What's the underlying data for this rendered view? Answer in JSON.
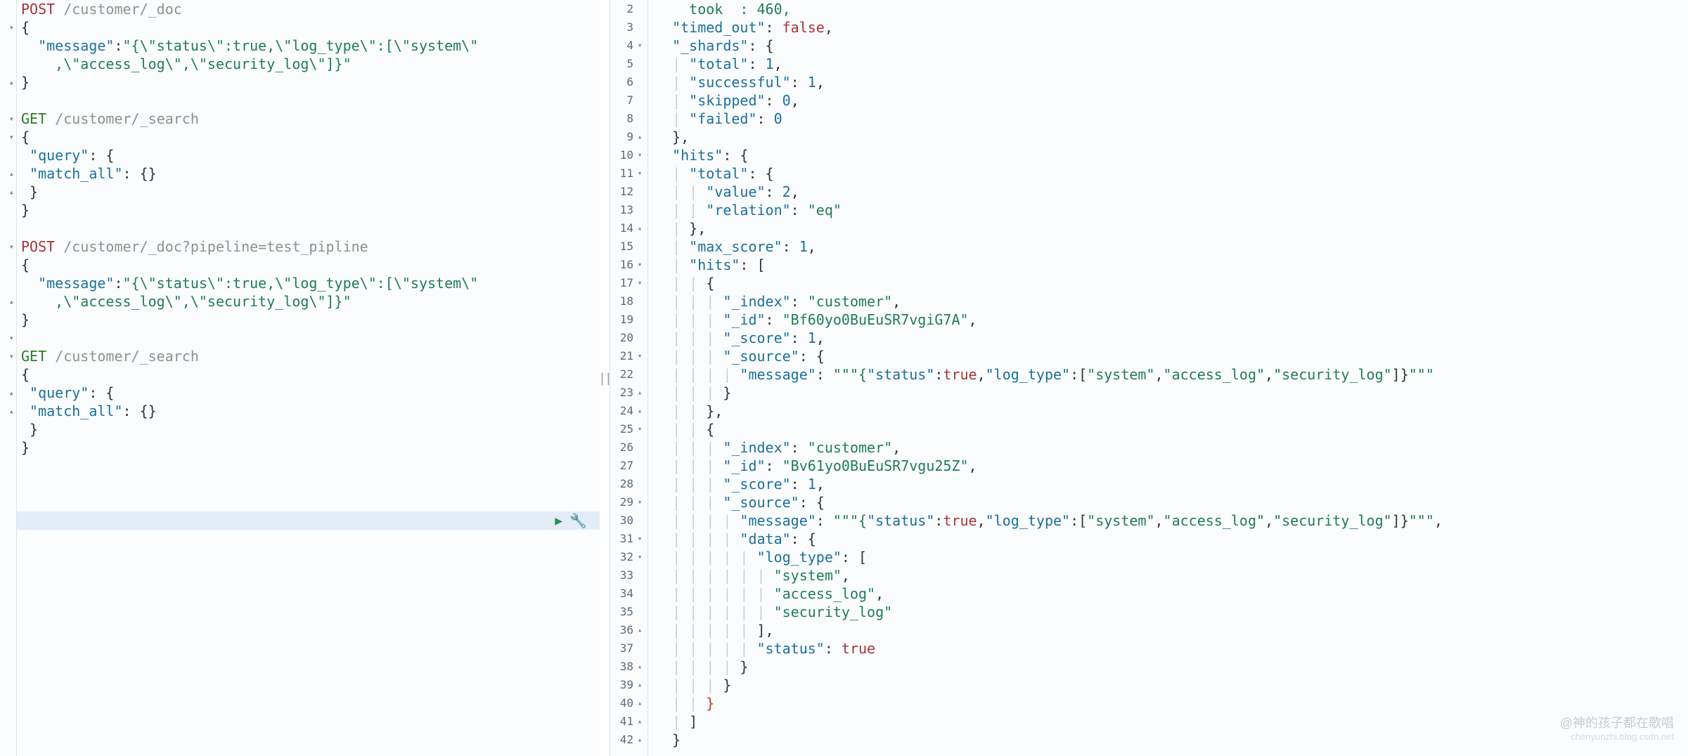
{
  "watermark": {
    "line1": "@神的孩子都在歌唱",
    "line2": "chenyunzhi.blog.csdn.net"
  },
  "icons": {
    "play": "▶",
    "wrench": "🔧",
    "divider": "||"
  },
  "left_fold_markers": {
    "1": "▾",
    "4": "▴",
    "6": "▾",
    "7": "▾",
    "9": "▴",
    "10": "▴",
    "13": "▾",
    "16": "▴",
    "18": "▾",
    "19": "▾",
    "21": "▴",
    "22": "▴"
  },
  "left_lines": [
    [
      {
        "c": "tok-method-post",
        "t": "POST"
      },
      {
        "c": "",
        "t": " "
      },
      {
        "c": "tok-path",
        "t": "/customer/_doc"
      }
    ],
    [
      {
        "c": "tok-punc",
        "t": "{"
      }
    ],
    [
      {
        "c": "",
        "t": "  "
      },
      {
        "c": "tok-key",
        "t": "\"message\""
      },
      {
        "c": "tok-punc",
        "t": ":"
      },
      {
        "c": "tok-string",
        "t": "\"{\\\"status\\\":true,\\\"log_type\\\":[\\\"system\\\""
      }
    ],
    [
      {
        "c": "",
        "t": "    "
      },
      {
        "c": "tok-string",
        "t": ",\\\"access_log\\\",\\\"security_log\\\"]}\""
      }
    ],
    [
      {
        "c": "tok-punc",
        "t": "}"
      }
    ],
    [
      {
        "c": "",
        "t": ""
      }
    ],
    [
      {
        "c": "tok-method-get",
        "t": "GET"
      },
      {
        "c": "",
        "t": " "
      },
      {
        "c": "tok-path",
        "t": "/customer/_search"
      }
    ],
    [
      {
        "c": "tok-punc",
        "t": "{"
      }
    ],
    [
      {
        "c": "",
        "t": " "
      },
      {
        "c": "tok-key",
        "t": "\"query\""
      },
      {
        "c": "tok-punc",
        "t": ": {"
      }
    ],
    [
      {
        "c": "",
        "t": " "
      },
      {
        "c": "tok-key",
        "t": "\"match_all\""
      },
      {
        "c": "tok-punc",
        "t": ": {}"
      }
    ],
    [
      {
        "c": "",
        "t": " "
      },
      {
        "c": "tok-punc",
        "t": "}"
      }
    ],
    [
      {
        "c": "tok-punc",
        "t": "}"
      }
    ],
    [
      {
        "c": "",
        "t": ""
      }
    ],
    [
      {
        "c": "tok-method-post",
        "t": "POST"
      },
      {
        "c": "",
        "t": " "
      },
      {
        "c": "tok-path",
        "t": "/customer/_doc?pipeline=test_pipline"
      }
    ],
    [
      {
        "c": "tok-punc",
        "t": "{"
      }
    ],
    [
      {
        "c": "",
        "t": "  "
      },
      {
        "c": "tok-key",
        "t": "\"message\""
      },
      {
        "c": "tok-punc",
        "t": ":"
      },
      {
        "c": "tok-string",
        "t": "\"{\\\"status\\\":true,\\\"log_type\\\":[\\\"system\\\""
      }
    ],
    [
      {
        "c": "",
        "t": "    "
      },
      {
        "c": "tok-string",
        "t": ",\\\"access_log\\\",\\\"security_log\\\"]}\""
      }
    ],
    [
      {
        "c": "tok-punc",
        "t": "}"
      }
    ],
    [
      {
        "c": "",
        "t": ""
      }
    ],
    [
      {
        "c": "tok-method-get",
        "t": "GET"
      },
      {
        "c": "",
        "t": " "
      },
      {
        "c": "tok-path",
        "t": "/customer/_search"
      }
    ],
    [
      {
        "c": "tok-punc",
        "t": "{"
      }
    ],
    [
      {
        "c": "",
        "t": " "
      },
      {
        "c": "tok-key",
        "t": "\"query\""
      },
      {
        "c": "tok-punc",
        "t": ": {"
      }
    ],
    [
      {
        "c": "",
        "t": " "
      },
      {
        "c": "tok-key",
        "t": "\"match_all\""
      },
      {
        "c": "tok-punc",
        "t": ": {}"
      }
    ],
    [
      {
        "c": "",
        "t": " "
      },
      {
        "c": "tok-punc",
        "t": "}"
      }
    ],
    [
      {
        "c": "tok-punc",
        "t": "}"
      }
    ]
  ],
  "right_gutter": [
    {
      "n": "2",
      "f": ""
    },
    {
      "n": "3",
      "f": ""
    },
    {
      "n": "4",
      "f": "▾"
    },
    {
      "n": "5",
      "f": ""
    },
    {
      "n": "6",
      "f": ""
    },
    {
      "n": "7",
      "f": ""
    },
    {
      "n": "8",
      "f": ""
    },
    {
      "n": "9",
      "f": "▴"
    },
    {
      "n": "10",
      "f": "▾"
    },
    {
      "n": "11",
      "f": "▾"
    },
    {
      "n": "12",
      "f": ""
    },
    {
      "n": "13",
      "f": ""
    },
    {
      "n": "14",
      "f": "▴"
    },
    {
      "n": "15",
      "f": ""
    },
    {
      "n": "16",
      "f": "▾"
    },
    {
      "n": "17",
      "f": "▾"
    },
    {
      "n": "18",
      "f": ""
    },
    {
      "n": "19",
      "f": ""
    },
    {
      "n": "20",
      "f": ""
    },
    {
      "n": "21",
      "f": "▾"
    },
    {
      "n": "22",
      "f": ""
    },
    {
      "n": "23",
      "f": "▴"
    },
    {
      "n": "24",
      "f": "▴"
    },
    {
      "n": "25",
      "f": "▾"
    },
    {
      "n": "26",
      "f": ""
    },
    {
      "n": "27",
      "f": ""
    },
    {
      "n": "28",
      "f": ""
    },
    {
      "n": "29",
      "f": "▾"
    },
    {
      "n": "30",
      "f": ""
    },
    {
      "n": "31",
      "f": "▾"
    },
    {
      "n": "32",
      "f": "▾"
    },
    {
      "n": "33",
      "f": ""
    },
    {
      "n": "34",
      "f": ""
    },
    {
      "n": "35",
      "f": ""
    },
    {
      "n": "36",
      "f": "▴"
    },
    {
      "n": "37",
      "f": ""
    },
    {
      "n": "38",
      "f": "▴"
    },
    {
      "n": "39",
      "f": "▴"
    },
    {
      "n": "40",
      "f": "▴"
    },
    {
      "n": "41",
      "f": "▴"
    },
    {
      "n": "42",
      "f": "▴"
    }
  ],
  "right_lines": [
    [
      {
        "c": "",
        "t": "  "
      },
      {
        "c": "tok-string",
        "t": "  took  : 460,"
      }
    ],
    [
      {
        "c": "",
        "t": "  "
      },
      {
        "c": "tok-key",
        "t": "\"timed_out\""
      },
      {
        "c": "tok-punc",
        "t": ": "
      },
      {
        "c": "tok-bool",
        "t": "false"
      },
      {
        "c": "tok-punc",
        "t": ","
      }
    ],
    [
      {
        "c": "",
        "t": "  "
      },
      {
        "c": "tok-key",
        "t": "\"_shards\""
      },
      {
        "c": "tok-punc",
        "t": ": {"
      }
    ],
    [
      {
        "c": "indent-guide",
        "t": "  | "
      },
      {
        "c": "tok-key",
        "t": "\"total\""
      },
      {
        "c": "tok-punc",
        "t": ": "
      },
      {
        "c": "tok-number",
        "t": "1"
      },
      {
        "c": "tok-punc",
        "t": ","
      }
    ],
    [
      {
        "c": "indent-guide",
        "t": "  | "
      },
      {
        "c": "tok-key",
        "t": "\"successful\""
      },
      {
        "c": "tok-punc",
        "t": ": "
      },
      {
        "c": "tok-number",
        "t": "1"
      },
      {
        "c": "tok-punc",
        "t": ","
      }
    ],
    [
      {
        "c": "indent-guide",
        "t": "  | "
      },
      {
        "c": "tok-key",
        "t": "\"skipped\""
      },
      {
        "c": "tok-punc",
        "t": ": "
      },
      {
        "c": "tok-number",
        "t": "0"
      },
      {
        "c": "tok-punc",
        "t": ","
      }
    ],
    [
      {
        "c": "indent-guide",
        "t": "  | "
      },
      {
        "c": "tok-key",
        "t": "\"failed\""
      },
      {
        "c": "tok-punc",
        "t": ": "
      },
      {
        "c": "tok-number",
        "t": "0"
      }
    ],
    [
      {
        "c": "",
        "t": "  "
      },
      {
        "c": "tok-punc",
        "t": "},"
      }
    ],
    [
      {
        "c": "",
        "t": "  "
      },
      {
        "c": "tok-key",
        "t": "\"hits\""
      },
      {
        "c": "tok-punc",
        "t": ": {"
      }
    ],
    [
      {
        "c": "indent-guide",
        "t": "  | "
      },
      {
        "c": "tok-key",
        "t": "\"total\""
      },
      {
        "c": "tok-punc",
        "t": ": {"
      }
    ],
    [
      {
        "c": "indent-guide",
        "t": "  | | "
      },
      {
        "c": "tok-key",
        "t": "\"value\""
      },
      {
        "c": "tok-punc",
        "t": ": "
      },
      {
        "c": "tok-number",
        "t": "2"
      },
      {
        "c": "tok-punc",
        "t": ","
      }
    ],
    [
      {
        "c": "indent-guide",
        "t": "  | | "
      },
      {
        "c": "tok-key",
        "t": "\"relation\""
      },
      {
        "c": "tok-punc",
        "t": ": "
      },
      {
        "c": "tok-string",
        "t": "\"eq\""
      }
    ],
    [
      {
        "c": "indent-guide",
        "t": "  | "
      },
      {
        "c": "tok-punc",
        "t": "},"
      }
    ],
    [
      {
        "c": "indent-guide",
        "t": "  | "
      },
      {
        "c": "tok-key",
        "t": "\"max_score\""
      },
      {
        "c": "tok-punc",
        "t": ": "
      },
      {
        "c": "tok-number",
        "t": "1"
      },
      {
        "c": "tok-punc",
        "t": ","
      }
    ],
    [
      {
        "c": "indent-guide",
        "t": "  | "
      },
      {
        "c": "tok-key",
        "t": "\"hits\""
      },
      {
        "c": "tok-punc",
        "t": ": ["
      }
    ],
    [
      {
        "c": "indent-guide",
        "t": "  | | "
      },
      {
        "c": "tok-punc",
        "t": "{"
      }
    ],
    [
      {
        "c": "indent-guide",
        "t": "  | | | "
      },
      {
        "c": "tok-key",
        "t": "\"_index\""
      },
      {
        "c": "tok-punc",
        "t": ": "
      },
      {
        "c": "tok-string",
        "t": "\"customer\""
      },
      {
        "c": "tok-punc",
        "t": ","
      }
    ],
    [
      {
        "c": "indent-guide",
        "t": "  | | | "
      },
      {
        "c": "tok-key",
        "t": "\"_id\""
      },
      {
        "c": "tok-punc",
        "t": ": "
      },
      {
        "c": "tok-string",
        "t": "\"Bf60yo0BuEuSR7vgiG7A\""
      },
      {
        "c": "tok-punc",
        "t": ","
      }
    ],
    [
      {
        "c": "indent-guide",
        "t": "  | | | "
      },
      {
        "c": "tok-key",
        "t": "\"_score\""
      },
      {
        "c": "tok-punc",
        "t": ": "
      },
      {
        "c": "tok-number",
        "t": "1"
      },
      {
        "c": "tok-punc",
        "t": ","
      }
    ],
    [
      {
        "c": "indent-guide",
        "t": "  | | | "
      },
      {
        "c": "tok-key",
        "t": "\"_source\""
      },
      {
        "c": "tok-punc",
        "t": ": {"
      }
    ],
    [
      {
        "c": "indent-guide",
        "t": "  | | | | "
      },
      {
        "c": "tok-key",
        "t": "\"message\""
      },
      {
        "c": "tok-punc",
        "t": ": "
      },
      {
        "c": "tok-string",
        "t": "\"\"\"{"
      },
      {
        "c": "tok-key",
        "t": "\"status\""
      },
      {
        "c": "tok-punc",
        "t": ":"
      },
      {
        "c": "tok-bool",
        "t": "true"
      },
      {
        "c": "tok-punc",
        "t": ","
      },
      {
        "c": "tok-key",
        "t": "\"log_type\""
      },
      {
        "c": "tok-punc",
        "t": ":["
      },
      {
        "c": "tok-string",
        "t": "\"system\""
      },
      {
        "c": "tok-punc",
        "t": ","
      },
      {
        "c": "tok-string",
        "t": "\"access_log\""
      },
      {
        "c": "tok-punc",
        "t": ","
      },
      {
        "c": "tok-string",
        "t": "\"security_log\""
      },
      {
        "c": "tok-punc",
        "t": "]}"
      },
      {
        "c": "tok-string",
        "t": "\"\"\""
      }
    ],
    [
      {
        "c": "indent-guide",
        "t": "  | | | "
      },
      {
        "c": "tok-punc",
        "t": "}"
      }
    ],
    [
      {
        "c": "indent-guide",
        "t": "  | | "
      },
      {
        "c": "tok-punc",
        "t": "},"
      }
    ],
    [
      {
        "c": "indent-guide",
        "t": "  | | "
      },
      {
        "c": "tok-punc",
        "t": "{"
      }
    ],
    [
      {
        "c": "indent-guide",
        "t": "  | | | "
      },
      {
        "c": "tok-key",
        "t": "\"_index\""
      },
      {
        "c": "tok-punc",
        "t": ": "
      },
      {
        "c": "tok-string",
        "t": "\"customer\""
      },
      {
        "c": "tok-punc",
        "t": ","
      }
    ],
    [
      {
        "c": "indent-guide",
        "t": "  | | | "
      },
      {
        "c": "tok-key",
        "t": "\"_id\""
      },
      {
        "c": "tok-punc",
        "t": ": "
      },
      {
        "c": "tok-string",
        "t": "\"Bv61yo0BuEuSR7vgu25Z\""
      },
      {
        "c": "tok-punc",
        "t": ","
      }
    ],
    [
      {
        "c": "indent-guide",
        "t": "  | | | "
      },
      {
        "c": "tok-key",
        "t": "\"_score\""
      },
      {
        "c": "tok-punc",
        "t": ": "
      },
      {
        "c": "tok-number",
        "t": "1"
      },
      {
        "c": "tok-punc",
        "t": ","
      }
    ],
    [
      {
        "c": "indent-guide",
        "t": "  | | | "
      },
      {
        "c": "tok-key",
        "t": "\"_source\""
      },
      {
        "c": "tok-punc",
        "t": ": {"
      }
    ],
    [
      {
        "c": "indent-guide",
        "t": "  | | | | "
      },
      {
        "c": "tok-key",
        "t": "\"message\""
      },
      {
        "c": "tok-punc",
        "t": ": "
      },
      {
        "c": "tok-string",
        "t": "\"\"\"{"
      },
      {
        "c": "tok-key",
        "t": "\"status\""
      },
      {
        "c": "tok-punc",
        "t": ":"
      },
      {
        "c": "tok-bool",
        "t": "true"
      },
      {
        "c": "tok-punc",
        "t": ","
      },
      {
        "c": "tok-key",
        "t": "\"log_type\""
      },
      {
        "c": "tok-punc",
        "t": ":["
      },
      {
        "c": "tok-string",
        "t": "\"system\""
      },
      {
        "c": "tok-punc",
        "t": ","
      },
      {
        "c": "tok-string",
        "t": "\"access_log\""
      },
      {
        "c": "tok-punc",
        "t": ","
      },
      {
        "c": "tok-string",
        "t": "\"security_log\""
      },
      {
        "c": "tok-punc",
        "t": "]}"
      },
      {
        "c": "tok-string",
        "t": "\"\"\""
      },
      {
        "c": "tok-punc",
        "t": ","
      }
    ],
    [
      {
        "c": "indent-guide",
        "t": "  | | | | "
      },
      {
        "c": "tok-key",
        "t": "\"data\""
      },
      {
        "c": "tok-punc",
        "t": ": {"
      }
    ],
    [
      {
        "c": "indent-guide",
        "t": "  | | | | | "
      },
      {
        "c": "tok-key",
        "t": "\"log_type\""
      },
      {
        "c": "tok-punc",
        "t": ": ["
      }
    ],
    [
      {
        "c": "indent-guide",
        "t": "  | | | | | | "
      },
      {
        "c": "tok-string",
        "t": "\"system\""
      },
      {
        "c": "tok-punc",
        "t": ","
      }
    ],
    [
      {
        "c": "indent-guide",
        "t": "  | | | | | | "
      },
      {
        "c": "tok-string",
        "t": "\"access_log\""
      },
      {
        "c": "tok-punc",
        "t": ","
      }
    ],
    [
      {
        "c": "indent-guide",
        "t": "  | | | | | | "
      },
      {
        "c": "tok-string",
        "t": "\"security_log\""
      }
    ],
    [
      {
        "c": "indent-guide",
        "t": "  | | | | | "
      },
      {
        "c": "tok-punc",
        "t": "],"
      }
    ],
    [
      {
        "c": "indent-guide",
        "t": "  | | | | | "
      },
      {
        "c": "tok-key",
        "t": "\"status\""
      },
      {
        "c": "tok-punc",
        "t": ": "
      },
      {
        "c": "tok-bool",
        "t": "true"
      }
    ],
    [
      {
        "c": "indent-guide",
        "t": "  | | | | "
      },
      {
        "c": "tok-punc",
        "t": "}"
      }
    ],
    [
      {
        "c": "indent-guide",
        "t": "  | | | "
      },
      {
        "c": "tok-punc",
        "t": "}"
      }
    ],
    [
      {
        "c": "indent-guide",
        "t": "  | | "
      },
      {
        "c": "tok-brace-end",
        "t": "}"
      }
    ],
    [
      {
        "c": "indent-guide",
        "t": "  | "
      },
      {
        "c": "tok-punc",
        "t": "]"
      }
    ],
    [
      {
        "c": "",
        "t": "  "
      },
      {
        "c": "tok-punc",
        "t": "}"
      }
    ]
  ]
}
